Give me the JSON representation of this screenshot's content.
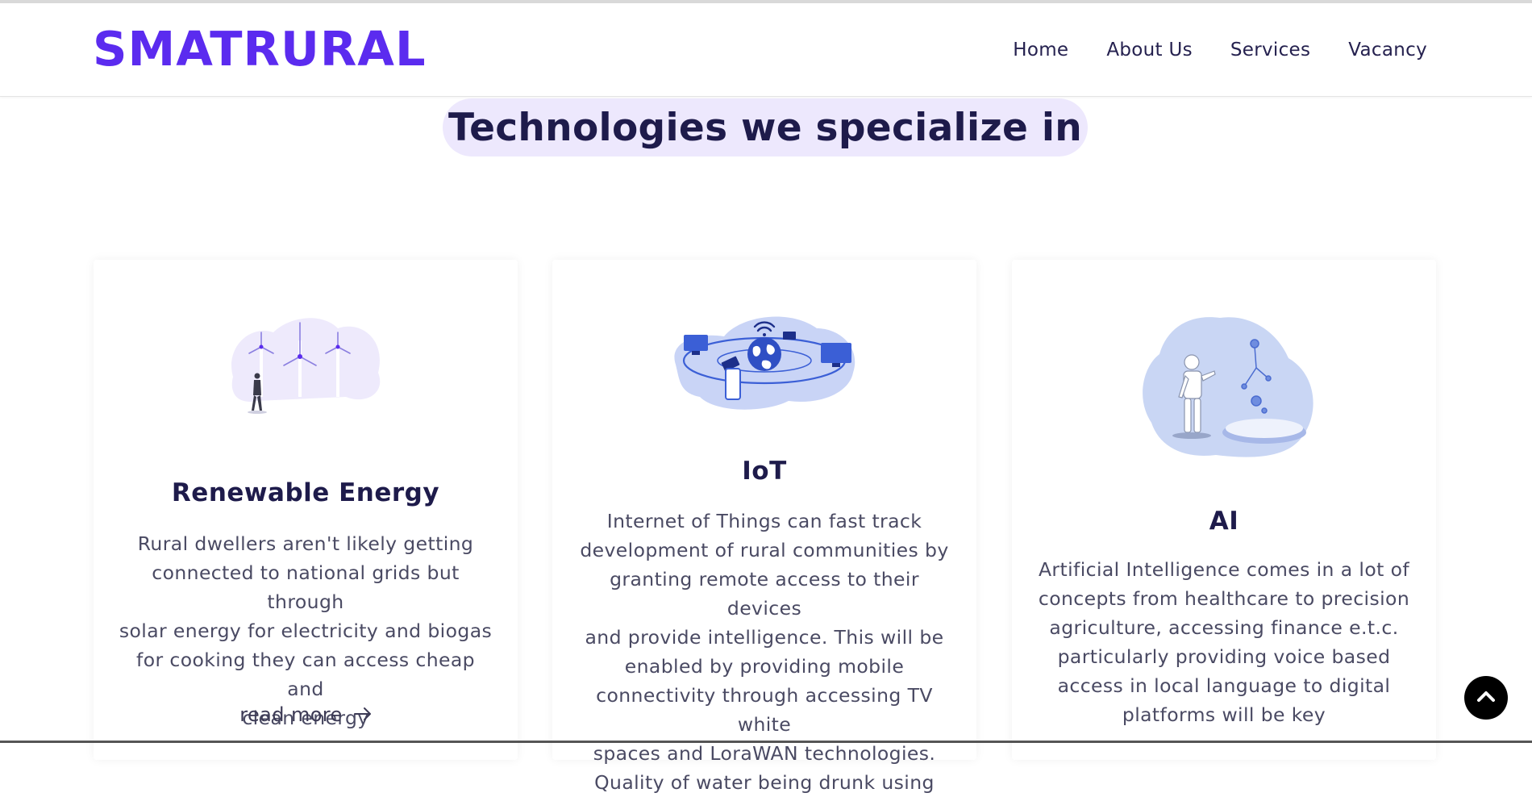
{
  "header": {
    "logo": "SMATRURAL",
    "nav": [
      "Home",
      "About Us",
      "Services",
      "Vacancy"
    ]
  },
  "section": {
    "title": "Technologies we specialize in"
  },
  "cards": [
    {
      "title": "Renewable Energy",
      "illustration": "wind-turbines-illustration",
      "lines": [
        "Rural dwellers aren't likely getting",
        "connected to national grids but through",
        "solar energy for electricity and biogas",
        "for cooking they can access cheap and",
        "clean energy"
      ],
      "read_more": "read more"
    },
    {
      "title": "IoT",
      "illustration": "connected-globe-illustration",
      "lines": [
        "Internet of Things can fast track",
        "development of rural communities by",
        "granting remote access to their devices",
        "and provide intelligence. This will be",
        "enabled by providing mobile",
        "connectivity through accessing TV white",
        "spaces and LoraWAN technologies.",
        "Quality of water being drunk using"
      ]
    },
    {
      "title": "AI",
      "illustration": "robot-hologram-illustration",
      "lines": [
        "Artificial Intelligence comes in a lot of",
        "concepts from healthcare to precision",
        "agriculture, accessing finance e.t.c.",
        "particularly providing voice based",
        "access in local language to digital",
        "platforms will be key"
      ]
    }
  ],
  "colors": {
    "brand": "#5b2bef",
    "heading": "#1e1b4b",
    "title_pill": "#ede8fd",
    "body_text": "#4a4a63"
  },
  "icons": {
    "read_more_arrow": "arrow-right-icon",
    "scroll_top": "chevron-up-icon"
  }
}
